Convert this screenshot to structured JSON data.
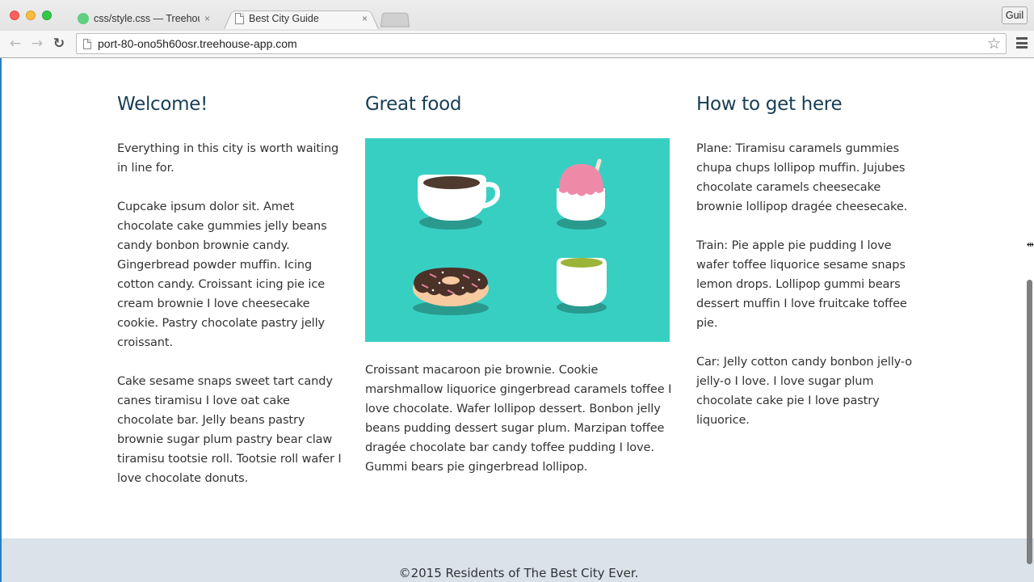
{
  "browser": {
    "tabs": [
      {
        "title": "css/style.css — Treehouse",
        "favicon": "treehouse-icon",
        "active": false
      },
      {
        "title": "Best City Guide",
        "favicon": "page-icon",
        "active": true
      }
    ],
    "close_glyph": "×",
    "profile_label": "Guil",
    "url": "port-80-ono5h60osr.treehouse-app.com",
    "icons": {
      "back": "←",
      "forward": "→",
      "reload": "↻",
      "star": "☆"
    }
  },
  "page": {
    "columns": [
      {
        "heading": "Welcome!",
        "paragraphs": [
          "Everything in this city is worth waiting in line for.",
          "Cupcake ipsum dolor sit. Amet chocolate cake gummies jelly beans candy bonbon brownie candy. Gingerbread powder muffin. Icing cotton candy. Croissant icing pie ice cream brownie I love cheesecake cookie. Pastry chocolate pastry jelly croissant.",
          "Cake sesame snaps sweet tart candy canes tiramisu I love oat cake chocolate bar. Jelly beans pastry brownie sugar plum pastry bear claw tiramisu tootsie roll. Tootsie roll wafer I love chocolate donuts."
        ]
      },
      {
        "heading": "Great food",
        "image": {
          "alt": "Illustration of coffee cup, shaved ice, donut and green tea",
          "background": "#38cfc3"
        },
        "paragraphs": [
          "Croissant macaroon pie brownie. Cookie marshmallow liquorice gingerbread caramels toffee I love chocolate. Wafer lollipop dessert. Bonbon jelly beans pudding dessert sugar plum. Marzipan toffee dragée chocolate bar candy toffee pudding I love. Gummi bears pie gingerbread lollipop."
        ]
      },
      {
        "heading": "How to get here",
        "paragraphs": [
          "Plane: Tiramisu caramels gummies chupa chups lollipop muffin. Jujubes chocolate caramels cheesecake brownie lollipop dragée cheesecake.",
          "Train: Pie apple pie pudding I love wafer toffee liquorice sesame snaps lemon drops. Lollipop gummi bears dessert muffin I love fruitcake toffee pie.",
          "Car: Jelly cotton candy bonbon jelly-o jelly-o I love. I love sugar plum chocolate cake pie I love pastry liquorice."
        ]
      }
    ],
    "footer": "©2015 Residents of The Best City Ever.",
    "colors": {
      "heading": "#173e55",
      "body_text": "#333333",
      "footer_bg": "#d9e3e9",
      "image_bg": "#38cfc3"
    }
  }
}
